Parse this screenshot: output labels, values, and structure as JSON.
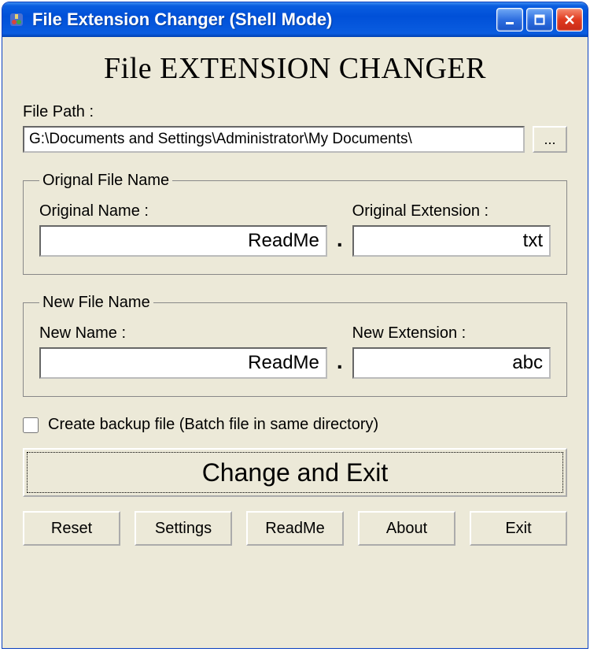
{
  "window": {
    "title": "File Extension Changer (Shell Mode)"
  },
  "app": {
    "title": "File EXTENSION CHANGER"
  },
  "filepath": {
    "label": "File Path :",
    "value": "G:\\Documents and Settings\\Administrator\\My Documents\\",
    "browse": "..."
  },
  "original": {
    "legend": "Orignal File Name",
    "name_label": "Original Name :",
    "name_value": "ReadMe",
    "ext_label": "Original Extension :",
    "ext_value": "txt"
  },
  "newfile": {
    "legend": "New File Name",
    "name_label": "New Name :",
    "name_value": "ReadMe",
    "ext_label": "New Extension :",
    "ext_value": "abc"
  },
  "backup": {
    "label": "Create backup file (Batch file in same directory)",
    "checked": false
  },
  "buttons": {
    "main": "Change and Exit",
    "reset": "Reset",
    "settings": "Settings",
    "readme": "ReadMe",
    "about": "About",
    "exit": "Exit"
  }
}
